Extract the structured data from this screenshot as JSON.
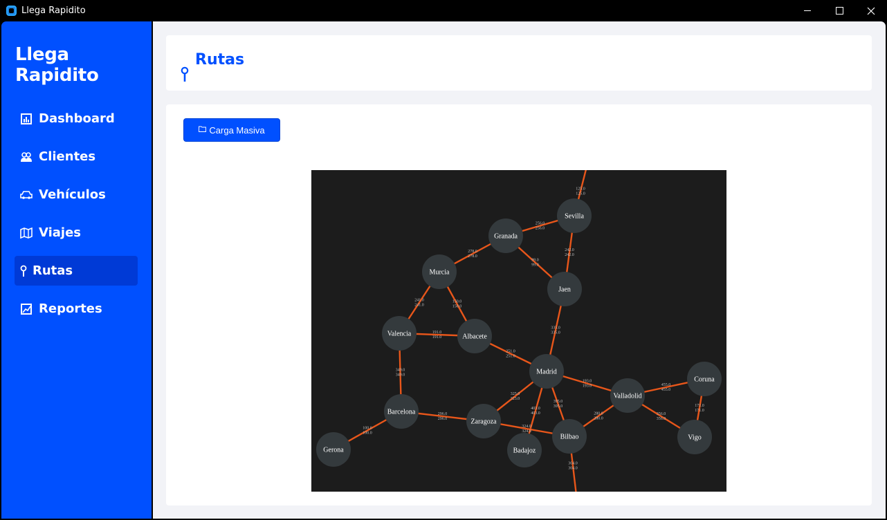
{
  "window": {
    "title": "Llega Rapidito"
  },
  "sidebar": {
    "brand": "Llega Rapidito",
    "items": [
      {
        "label": "Dashboard",
        "icon": "bar-chart-icon"
      },
      {
        "label": "Clientes",
        "icon": "people-icon"
      },
      {
        "label": "Vehículos",
        "icon": "car-icon"
      },
      {
        "label": "Viajes",
        "icon": "map-icon"
      },
      {
        "label": "Rutas",
        "icon": "pin-icon",
        "active": true
      },
      {
        "label": "Reportes",
        "icon": "chart-icon"
      }
    ]
  },
  "header": {
    "title": "Rutas"
  },
  "toolbar": {
    "load_label": "Carga Masiva"
  },
  "graph": {
    "nodes": [
      {
        "name": "Sevilla"
      },
      {
        "name": "Granada"
      },
      {
        "name": "Murcia"
      },
      {
        "name": "Jaen"
      },
      {
        "name": "Valencia"
      },
      {
        "name": "Albacete"
      },
      {
        "name": "Madrid"
      },
      {
        "name": "Coruna"
      },
      {
        "name": "Valladolid"
      },
      {
        "name": "Barcelona"
      },
      {
        "name": "Zaragoza"
      },
      {
        "name": "Bilbao"
      },
      {
        "name": "Vigo"
      },
      {
        "name": "Gerona"
      },
      {
        "name": "Badajoz"
      }
    ],
    "edges": [
      {
        "from": "Sevilla",
        "to": "",
        "labels": [
          "125.0",
          "125.0"
        ]
      },
      {
        "from": "Granada",
        "to": "Sevilla",
        "labels": [
          "256.0",
          "256.0"
        ]
      },
      {
        "from": "Sevilla",
        "to": "Jaen",
        "labels": [
          "242.0",
          "242.0"
        ]
      },
      {
        "from": "Murcia",
        "to": "Granada",
        "labels": [
          "278.0",
          "278.0"
        ]
      },
      {
        "from": "Granada",
        "to": "Jaen",
        "labels": [
          "99.0",
          "99.0"
        ]
      },
      {
        "from": "Murcia",
        "to": "Valencia",
        "labels": [
          "241.0",
          "241.0"
        ]
      },
      {
        "from": "Murcia",
        "to": "Albacete",
        "labels": [
          "150.0",
          "150.0"
        ]
      },
      {
        "from": "Valencia",
        "to": "Albacete",
        "labels": [
          "191.0",
          "191.0"
        ]
      },
      {
        "from": "Jaen",
        "to": "Madrid",
        "labels": [
          "335.0",
          "335.0"
        ]
      },
      {
        "from": "Albacete",
        "to": "Madrid",
        "labels": [
          "251.0",
          "251.0"
        ]
      },
      {
        "from": "Valencia",
        "to": "Barcelona",
        "labels": [
          "349.0",
          "349.0"
        ]
      },
      {
        "from": "Madrid",
        "to": "Valladolid",
        "labels": [
          "193.0",
          "193.0"
        ]
      },
      {
        "from": "Madrid",
        "to": "Zaragoza",
        "labels": [
          "325.0",
          "325.0"
        ]
      },
      {
        "from": "Madrid",
        "to": "Badajoz",
        "labels": [
          "403.0",
          "403.0"
        ]
      },
      {
        "from": "Madrid",
        "to": "Bilbao",
        "labels": [
          "395.0",
          "395.0"
        ]
      },
      {
        "from": "Valladolid",
        "to": "Coruna",
        "labels": [
          "455.0",
          "455.0"
        ]
      },
      {
        "from": "Coruna",
        "to": "Vigo",
        "labels": [
          "171.0",
          "171.0"
        ]
      },
      {
        "from": "Valladolid",
        "to": "Vigo",
        "labels": [
          "356.0",
          "356.0"
        ]
      },
      {
        "from": "Valladolid",
        "to": "Bilbao",
        "labels": [
          "280.0",
          "280.0"
        ]
      },
      {
        "from": "Barcelona",
        "to": "Zaragoza",
        "labels": [
          "296.0",
          "296.0"
        ]
      },
      {
        "from": "Barcelona",
        "to": "Gerona",
        "labels": [
          "100.0",
          "100.0"
        ]
      },
      {
        "from": "Zaragoza",
        "to": "Bilbao",
        "labels": [
          "324.0",
          "324.0"
        ]
      },
      {
        "from": "Bilbao",
        "to": "",
        "labels": [
          "304.0",
          "304.0"
        ]
      }
    ],
    "colors": {
      "background": "#1c1c1c",
      "node": "#343a3d",
      "edge": "#e8561a"
    }
  }
}
